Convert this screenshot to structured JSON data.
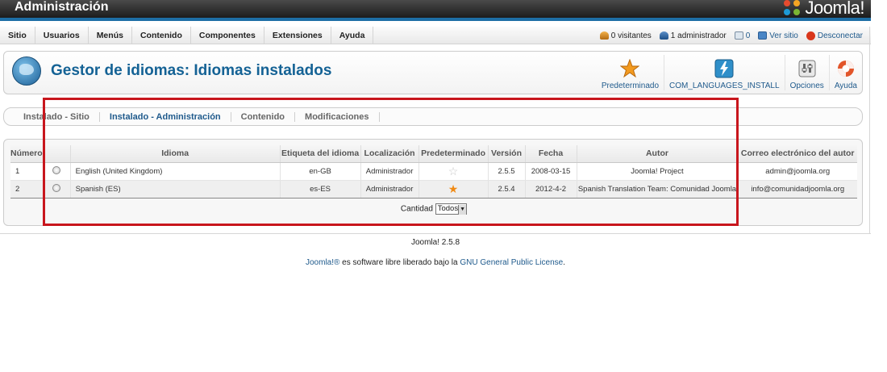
{
  "header": {
    "title": "Administración",
    "logo_text": "Joomla!"
  },
  "menu": [
    "Sitio",
    "Usuarios",
    "Menús",
    "Contenido",
    "Componentes",
    "Extensiones",
    "Ayuda"
  ],
  "status": {
    "visitors": "0 visitantes",
    "admins": "1 administrador",
    "messages": "0",
    "view_site": "Ver sitio",
    "logout": "Desconectar"
  },
  "toolbar": {
    "page_title": "Gestor de idiomas: Idiomas instalados",
    "buttons": [
      {
        "label": "Predeterminado",
        "icon": "star-icon"
      },
      {
        "label": "COM_LANGUAGES_INSTALL",
        "icon": "lightning-icon"
      },
      {
        "label": "Opciones",
        "icon": "options-icon"
      },
      {
        "label": "Ayuda",
        "icon": "help-lifebuoy-icon"
      }
    ]
  },
  "subtabs": [
    {
      "label": "Instalado - Sitio",
      "active": false
    },
    {
      "label": "Instalado - Administración",
      "active": true
    },
    {
      "label": "Contenido",
      "active": false
    },
    {
      "label": "Modificaciones",
      "active": false
    }
  ],
  "table": {
    "headers": [
      "Número",
      "",
      "Idioma",
      "Etiqueta del idioma",
      "Localización",
      "Predeterminado",
      "Versión",
      "Fecha",
      "Autor",
      "Correo electrónico del autor"
    ],
    "rows": [
      {
        "num": "1",
        "language": "English (United Kingdom)",
        "tag": "en-GB",
        "location": "Administrador",
        "default": false,
        "version": "2.5.5",
        "date": "2008-03-15",
        "author": "Joomla! Project",
        "email": "admin@joomla.org"
      },
      {
        "num": "2",
        "language": "Spanish (ES)",
        "tag": "es-ES",
        "location": "Administrador",
        "default": true,
        "version": "2.5.4",
        "date": "2012-4-2",
        "author": "Spanish Translation Team: Comunidad Joomla",
        "email": "info@comunidadjoomla.org"
      }
    ],
    "cantidad_label": "Cantidad",
    "cantidad_value": "Todos"
  },
  "footer": {
    "version": "Joomla! 2.5.8",
    "license_link1": "Joomla!®",
    "license_text": " es software libre liberado bajo la ",
    "license_link2": "GNU General Public License",
    "license_end": "."
  },
  "colors": {
    "accent": "#146295",
    "highlight": "#c8161d",
    "star_on": "#f08a14"
  }
}
